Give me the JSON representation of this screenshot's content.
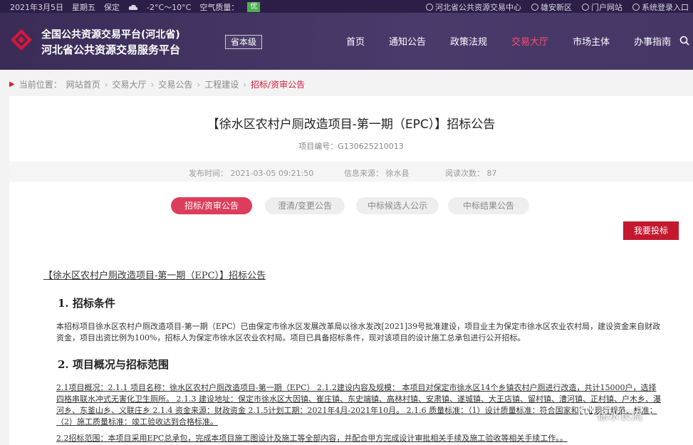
{
  "topbar": {
    "date": "2021年3月5日",
    "weekday": "星期五",
    "location": "保定",
    "weather_icon": "cloud-icon",
    "temperature": "-2°C～10°C",
    "air_quality_label": "空气质量：",
    "air_quality_value": "优",
    "air_quality_color": "#4caf50",
    "links": [
      "河北省公共资源交易中心",
      "雄安新区",
      "门户网站",
      "系统登录入口"
    ]
  },
  "header": {
    "title_line1": "全国公共资源交易平台(河北省)",
    "title_line2": "河北省公共资源交易服务平台",
    "level_label": "省本级",
    "nav": [
      "首页",
      "通知公告",
      "政策法规",
      "交易大厅",
      "市场主体",
      "办事指南"
    ],
    "active_nav": "交易大厅",
    "accent_color": "#ff4d6d"
  },
  "breadcrumb": {
    "prefix": "当前位置：",
    "items": [
      "网站首页",
      "交易大厅",
      "交易公告",
      "工程建设",
      "招标/资审公告"
    ]
  },
  "article": {
    "title": "【徐水区农村户厕改造项目-第一期（EPC）】招标公告",
    "project_no": "项目编号：G130625210013",
    "publish_time_label": "发布时间：",
    "publish_time": "2021-03-05 09:21:50",
    "source_label": "信息来源：",
    "source": "徐水县",
    "views_label": "阅读次数：",
    "views": "87",
    "tabs": [
      "招标/资审公告",
      "澄清/变更公告",
      "中标候选人公示",
      "中标结果公告"
    ],
    "bid_button": "我要投标",
    "doc_heading": "【徐水区农村户厕改造项目-第一期（EPC）】招标公告",
    "s1_title": "1.  招标条件",
    "s1_text": "本招标项目徐水区农村户厕改造项目-第一期（EPC）已由保定市徐水区发展改革局以徐水发改[2021]39号批准建设，项目业主为保定市徐水区农业农村局，建设资金来自财政资金，项目出资比例为100%，招标人为保定市徐水区农业农村局。项目已具备招标条件，现对该项目的设计施工总承包进行公开招标。",
    "s2_title": "2.  项目概况与招标范围",
    "s2_text": "2.1项目概况：2.1.1 项目名称：徐水区农村户厕改造项目-第一期（EPC） 2.1.2建设内容及规模： 本项目对保定市徐水区14个乡镇农村户厕进行改造，共计15000户，选择四格串联水冲式无害化卫生厕所。 2.1.3 建设地址：保定市徐水区大因镇、崔庄镇、东史端镇、高林村镇、安肃镇、遂城镇、大王店镇、留村镇、漕河镇、正村镇、户木乡、瀑河乡、东釜山乡、义联庄乡 2.1.4 资金来源：财政资金 2.1.5计划工期：2021年4月-2021年10月。 2.1.6 质量标准：（1）设计质量标准：符合国家和行业现行规范、标准； （2）施工质量标准：竣工验收达到合格标准。",
    "s2_text2": "2.2招标范围：本项目采用EPC总承包，完成本项目施工图设计及施工等全部内容，并配合甲方完成设计审批相关手续及施工验收等相关手续工作。。"
  },
  "watermark": "徐水长流"
}
